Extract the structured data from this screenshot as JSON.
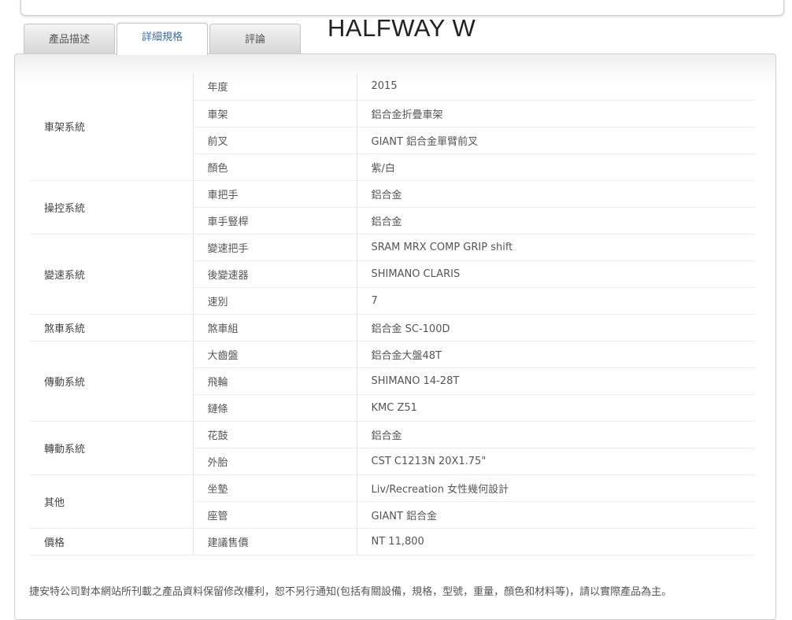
{
  "product_title": "HALFWAY W",
  "tabs": [
    {
      "label": "產品描述"
    },
    {
      "label": "詳細規格"
    },
    {
      "label": "評論"
    }
  ],
  "specs": [
    {
      "category": "車架系統",
      "rows": [
        {
          "item": "年度",
          "value": "2015"
        },
        {
          "item": "車架",
          "value": "鋁合金折疊車架"
        },
        {
          "item": "前叉",
          "value": "GIANT 鋁合金單臂前叉"
        },
        {
          "item": "顏色",
          "value": "紫/白"
        }
      ]
    },
    {
      "category": "操控系統",
      "rows": [
        {
          "item": "車把手",
          "value": "鋁合金"
        },
        {
          "item": "車手豎桿",
          "value": "鋁合金"
        }
      ]
    },
    {
      "category": "變速系統",
      "rows": [
        {
          "item": "變速把手",
          "value": "SRAM MRX COMP GRIP shift"
        },
        {
          "item": "後變速器",
          "value": "SHIMANO CLARIS"
        },
        {
          "item": "速別",
          "value": "7"
        }
      ]
    },
    {
      "category": "煞車系統",
      "rows": [
        {
          "item": "煞車組",
          "value": "鋁合金 SC-100D"
        }
      ]
    },
    {
      "category": "傳動系統",
      "rows": [
        {
          "item": "大齒盤",
          "value": "鋁合金大盤48T"
        },
        {
          "item": "飛輪",
          "value": "SHIMANO 14-28T"
        },
        {
          "item": "鏈條",
          "value": "KMC Z51"
        }
      ]
    },
    {
      "category": "轉動系統",
      "rows": [
        {
          "item": "花鼓",
          "value": "鋁合金"
        },
        {
          "item": "外胎",
          "value": "CST C1213N 20X1.75\""
        }
      ]
    },
    {
      "category": "其他",
      "rows": [
        {
          "item": "坐墊",
          "value": "Liv/Recreation 女性幾何設計"
        },
        {
          "item": "座管",
          "value": "GIANT 鋁合金"
        }
      ]
    },
    {
      "category": "價格",
      "rows": [
        {
          "item": "建議售價",
          "value": "NT 11,800"
        }
      ]
    }
  ],
  "disclaimer": "捷安特公司對本網站所刊載之產品資料保留修改權利，恕不另行通知(包括有關設備，規格，型號，重量，顏色和材料等)，請以實際產品為主。"
}
